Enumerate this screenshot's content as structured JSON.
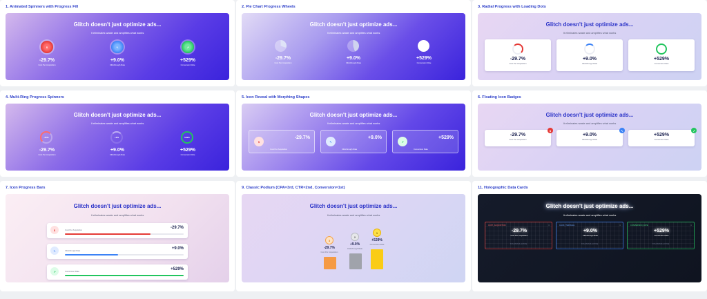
{
  "headline": "Glitch doesn't just optimize ads...",
  "subline": "It eliminates waste and amplifies what works",
  "metrics": [
    {
      "value": "-29.7%",
      "label": "Cost Per Acquisition",
      "color": "#e53935",
      "icon": "dollar-icon"
    },
    {
      "value": "+9.0%",
      "label": "Clickthrough Rate",
      "color": "#3b82f6",
      "icon": "cursor-icon"
    },
    {
      "value": "+529%",
      "label": "Conversion Rate",
      "color": "#22c55e",
      "icon": "trend-up-icon"
    }
  ],
  "panels": {
    "p1": "1. Animated Spinners with Progress Fill",
    "p2": "2. Pie Chart Progress Wheels",
    "p3": "3. Radial Progress with Loading Dots",
    "p4": "4. Multi-Ring Progress Spinners",
    "p5": "5. Icon Reveal with Morphing Shapes",
    "p6": "6. Floating Icon Badges",
    "p7": "7. Icon Progress Bars",
    "p9": "9. Classic Podium (CPA=3rd, CTR=2nd, Conversion=1st)",
    "p11": "11. Holographic Data Cards"
  },
  "ring_labels": [
    "-30%",
    "+9%",
    "529%"
  ],
  "podium_ranks": [
    "3",
    "2",
    "1"
  ],
  "holo_tags": [
    "COST_ACQUISITION",
    "CLICK_THROUGH",
    "CONVERSION_RATE"
  ],
  "holo_foot": [
    "SYS.STATUS: ACTIVE",
    "SYS.STATUS: ACTIVE",
    "SYS.STATUS: ACTIVE"
  ],
  "progress": {
    "cpa": 0.72,
    "ctr": 0.45,
    "conv": 1.0
  }
}
